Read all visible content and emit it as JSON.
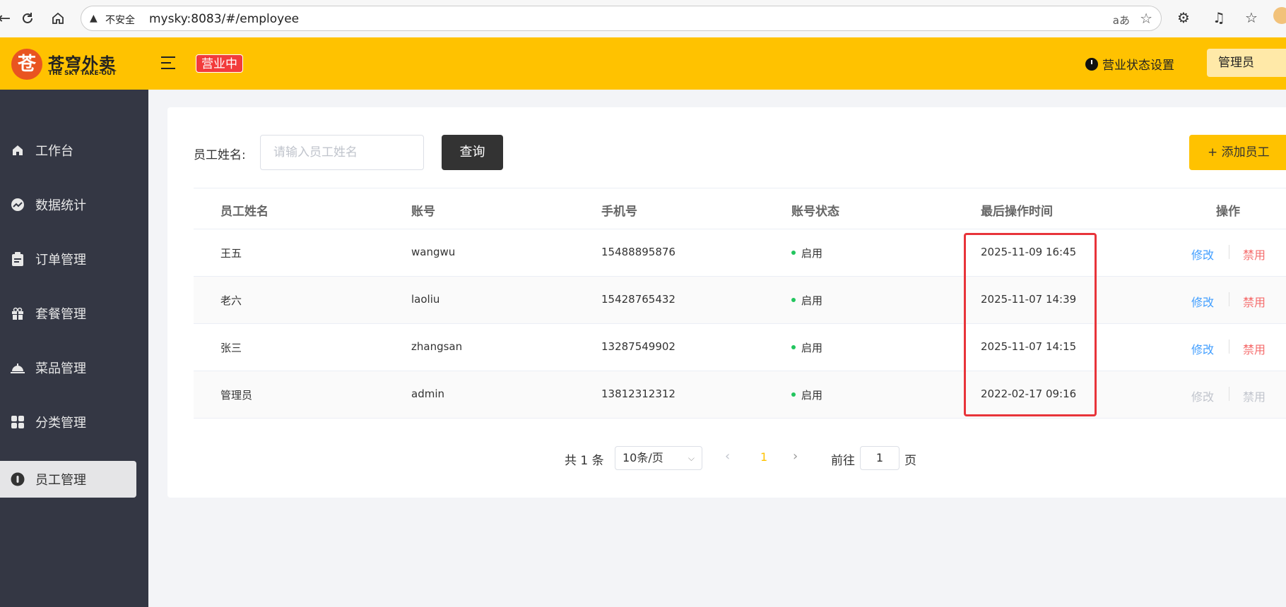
{
  "browser": {
    "security_warning": "不安全",
    "url": "mysky:8083/#/employee",
    "reader_label": "aあ"
  },
  "header": {
    "logo_cn": "苍穹外卖",
    "logo_en": "THE SKY TAKE-OUT",
    "business_status": "营业中",
    "status_settings": "营业状态设置",
    "user_label": "管理员"
  },
  "sidebar": {
    "items": [
      {
        "label": "工作台",
        "icon": "home-icon"
      },
      {
        "label": "数据统计",
        "icon": "chart-icon"
      },
      {
        "label": "订单管理",
        "icon": "clipboard-icon"
      },
      {
        "label": "套餐管理",
        "icon": "gift-icon"
      },
      {
        "label": "菜品管理",
        "icon": "dish-cover-icon"
      },
      {
        "label": "分类管理",
        "icon": "grid-icon"
      },
      {
        "label": "员工管理",
        "icon": "employee-icon",
        "active": true
      }
    ]
  },
  "search": {
    "label": "员工姓名:",
    "placeholder": "请输入员工姓名",
    "query_button": "查询",
    "add_button": "+ 添加员工"
  },
  "table": {
    "columns": [
      "员工姓名",
      "账号",
      "手机号",
      "账号状态",
      "最后操作时间",
      "操作"
    ],
    "rows": [
      {
        "name": "王五",
        "account": "wangwu",
        "phone": "15488895876",
        "status": "启用",
        "last_time": "2025-11-09 16:45",
        "edit": "修改",
        "disable": "禁用"
      },
      {
        "name": "老六",
        "account": "laoliu",
        "phone": "15428765432",
        "status": "启用",
        "last_time": "2025-11-07 14:39",
        "edit": "修改",
        "disable": "禁用"
      },
      {
        "name": "张三",
        "account": "zhangsan",
        "phone": "13287549902",
        "status": "启用",
        "last_time": "2025-11-07 14:15",
        "edit": "修改",
        "disable": "禁用"
      },
      {
        "name": "管理员",
        "account": "admin",
        "phone": "13812312312",
        "status": "启用",
        "last_time": "2022-02-17 09:16",
        "edit": "修改",
        "disable": "禁用"
      }
    ]
  },
  "pagination": {
    "total": "共 1 条",
    "page_size": "10条/页",
    "current_page": "1",
    "goto_prefix": "前往",
    "goto_value": "1",
    "goto_suffix": "页"
  },
  "colors": {
    "brand": "#ffc200",
    "sidebar": "#343744",
    "status_badge": "#f23b3b",
    "highlight": "#e8343a",
    "link": "#419eff",
    "danger": "#f56c6c",
    "enabled_dot": "#22c55e"
  }
}
